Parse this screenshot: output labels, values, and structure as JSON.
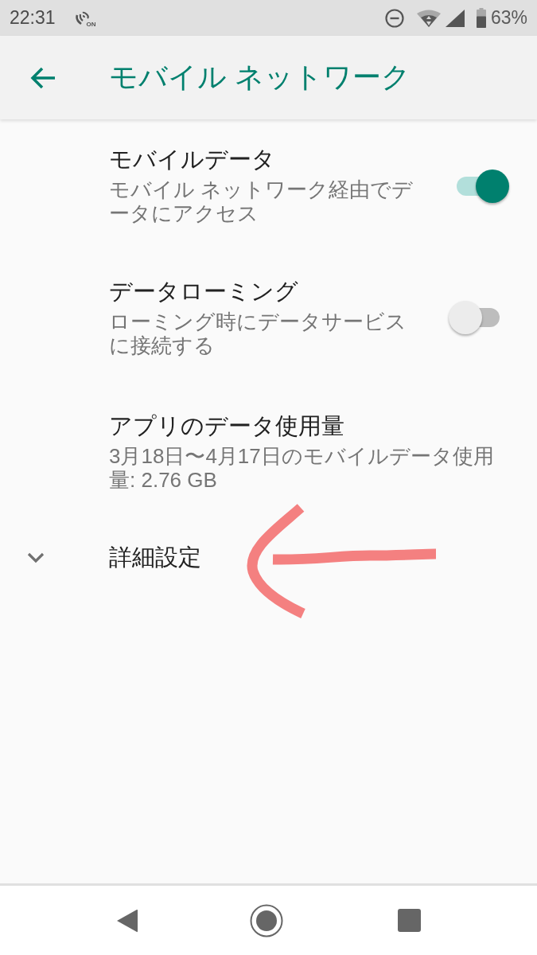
{
  "status_bar": {
    "time": "22:31",
    "nfc_label": "ON",
    "battery": "63%"
  },
  "app_bar": {
    "title": "モバイル ネットワーク"
  },
  "settings": [
    {
      "kind": "switch",
      "title": "モバイルデータ",
      "summary": "モバイル ネットワーク経由でデータにアクセス",
      "on": true
    },
    {
      "kind": "switch",
      "title": "データローミング",
      "summary": "ローミング時にデータサービスに接続する",
      "on": false
    },
    {
      "kind": "plain",
      "title": "アプリのデータ使用量",
      "summary": "3月18日〜4月17日のモバイルデータ使用量: 2.76 GB"
    }
  ],
  "advanced": {
    "label": "詳細設定",
    "expanded": false
  }
}
